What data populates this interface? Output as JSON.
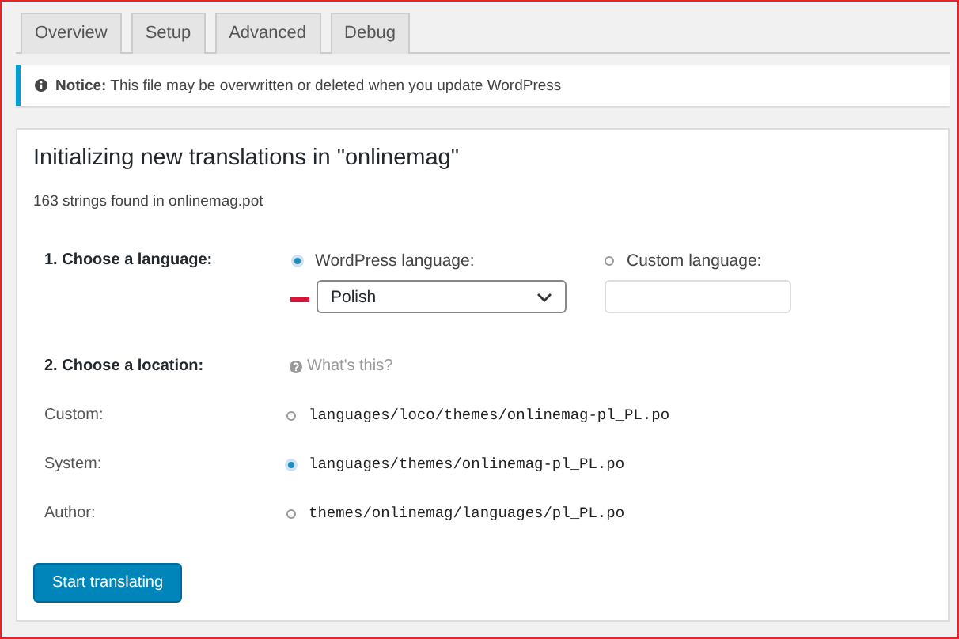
{
  "tabs": [
    {
      "label": "Overview",
      "selected": false
    },
    {
      "label": "Setup",
      "selected": false
    },
    {
      "label": "Advanced",
      "selected": false
    },
    {
      "label": "Debug",
      "selected": false
    }
  ],
  "notice": {
    "label": "Notice:",
    "text": "This file may be overwritten or deleted when you update WordPress"
  },
  "panel": {
    "title": "Initializing new translations in \"onlinemag\"",
    "subtitle": "163 strings found in onlinemag.pot",
    "language": {
      "label": "1. Choose a language:",
      "options": [
        {
          "label": "WordPress language:",
          "selected": true
        },
        {
          "label": "Custom language:",
          "selected": false
        }
      ],
      "select_value": "Polish"
    },
    "location": {
      "label": "2. Choose a location:",
      "help": "What's this?",
      "options": [
        {
          "label": "Custom:",
          "path": "languages/loco/themes/onlinemag-pl_PL.po",
          "selected": false
        },
        {
          "label": "System:",
          "path": "languages/themes/onlinemag-pl_PL.po",
          "selected": true
        },
        {
          "label": "Author:",
          "path": "themes/onlinemag/languages/pl_PL.po",
          "selected": false
        }
      ]
    },
    "button": "Start translating"
  }
}
